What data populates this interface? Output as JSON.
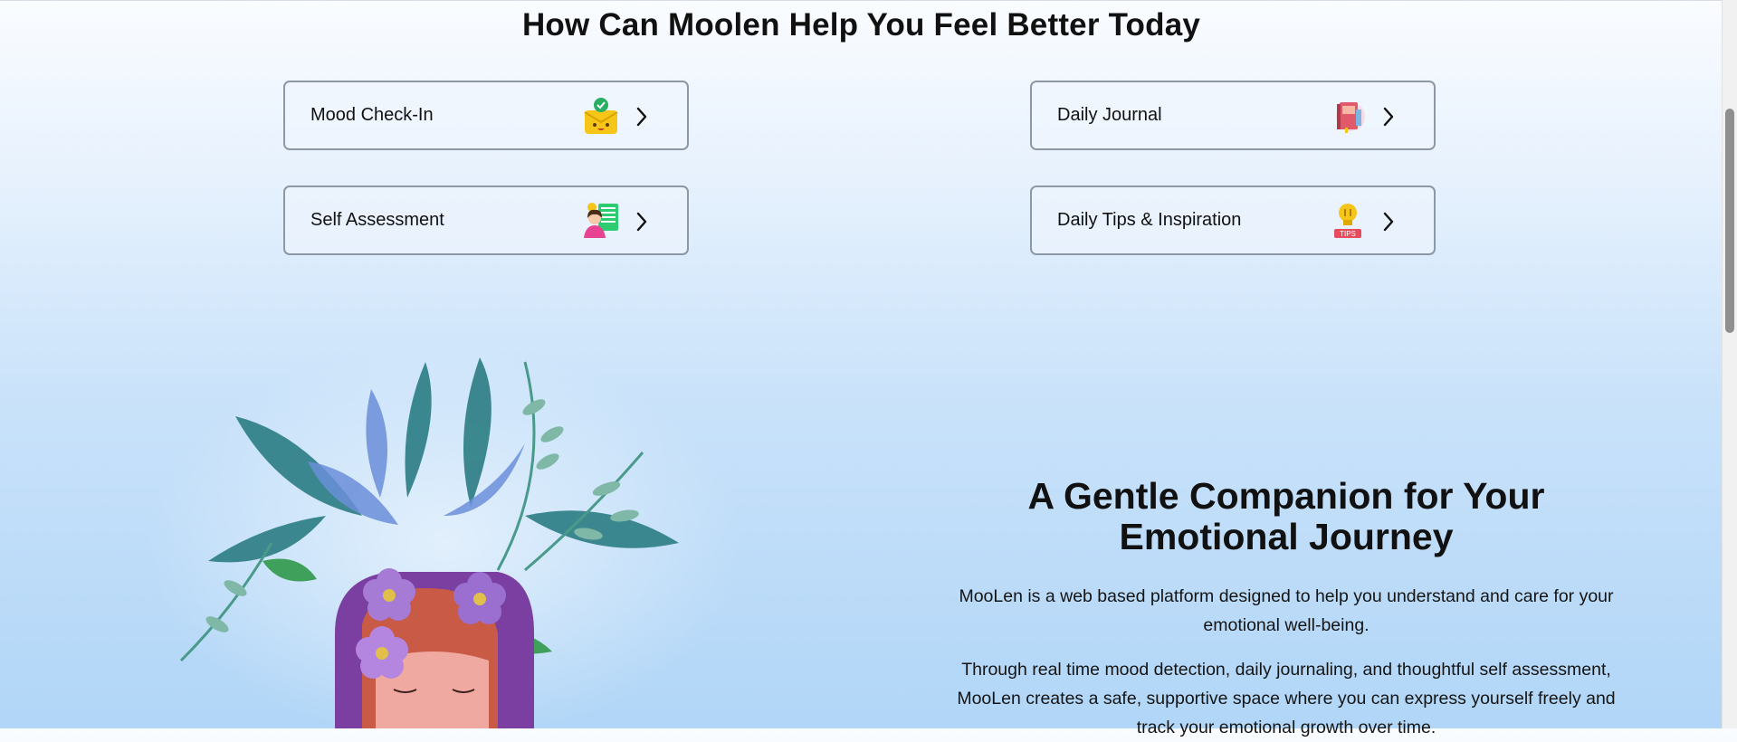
{
  "section": {
    "title": "How Can Moolen Help You Feel Better Today"
  },
  "features": [
    {
      "label": "Mood Check-In",
      "icon": "mood-checkin-icon"
    },
    {
      "label": "Daily Journal",
      "icon": "journal-icon"
    },
    {
      "label": "Self Assessment",
      "icon": "self-assessment-icon"
    },
    {
      "label": "Daily Tips & Inspiration",
      "icon": "tips-lightbulb-icon"
    }
  ],
  "tips_badge": "TIPS",
  "companion": {
    "title_line1": "A Gentle Companion for Your",
    "title_line2": "Emotional Journey",
    "paragraph1": "MooLen is a web based platform designed to help you understand and care for your emotional well-being.",
    "paragraph2": "Through real time mood detection, daily journaling, and thoughtful self assessment, MooLen creates a safe, supportive space where you can express yourself freely and track your emotional growth over time."
  },
  "colors": {
    "card_border": "#8d98a6",
    "bg_top": "#fafcff",
    "bg_bottom": "#b1d6f7",
    "leaf_teal": "#2f7f86",
    "flower_purple": "#9a6fd0"
  }
}
